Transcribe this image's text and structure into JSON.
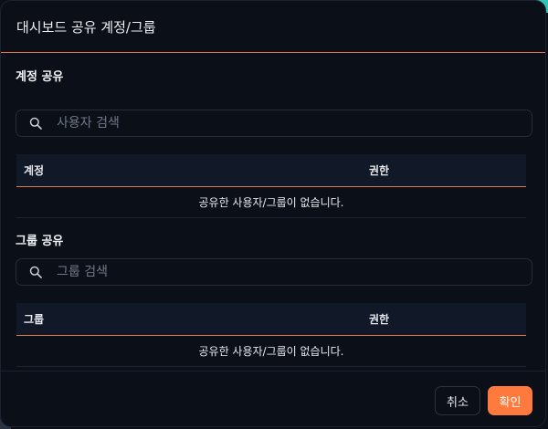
{
  "dialog": {
    "title": "대시보드 공유 계정/그룹"
  },
  "account_share": {
    "title": "계정 공유",
    "search_placeholder": "사용자 검색",
    "columns": [
      "계정",
      "권한"
    ],
    "empty_message": "공유한 사용자/그룹이 없습니다."
  },
  "group_share": {
    "title": "그룹 공유",
    "search_placeholder": "그룹 검색",
    "columns": [
      "그룹",
      "권한"
    ],
    "empty_message": "공유한 사용자/그룹이 없습니다."
  },
  "footer": {
    "cancel_label": "취소",
    "confirm_label": "확인"
  },
  "colors": {
    "accent": "#ff7a3c",
    "divider_accent": "#e0764a",
    "background": "#0b0f18",
    "header_row": "#111827"
  },
  "icons": [
    "search-icon"
  ]
}
